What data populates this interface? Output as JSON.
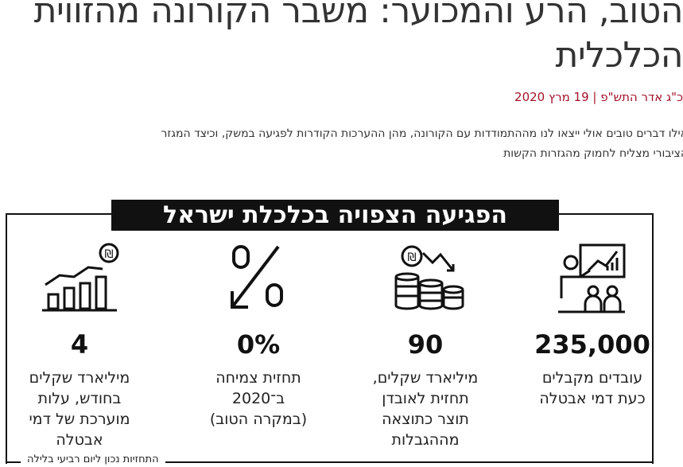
{
  "article": {
    "title_line1": "הטוב, הרע והמכוער: משבר הקורונה מהזווית",
    "title_line2": "הכלכלית",
    "dateline": "כ\"ג אדר התש\"פ | 19 מרץ 2020",
    "lead_line1": "אילו דברים טובים אולי ייצאו לנו מההתמודדות עם הקורונה, מהן ההערכות הקודרות לפגיעה במשק, וכיצד המגזר",
    "lead_line2": "הציבורי מצליח לחמוק מהגזרות הקשות"
  },
  "infographic": {
    "heading": "הפגיעה הצפויה בכלכלת ישראל",
    "footnote": "התחזיות נכון ליום רביעי בלילה",
    "stats": [
      {
        "value": "235,000",
        "desc_lines": [
          "עובדים מקבלים",
          "כעת דמי אבטלה"
        ],
        "icon": "presentation-icon"
      },
      {
        "value": "90",
        "desc_lines": [
          "מיליארד שקלים,",
          "תחזית לאובדן",
          "תוצר כתוצאה",
          "מההגבלות"
        ],
        "icon": "coins-down-icon"
      },
      {
        "value": "0%",
        "desc_lines": [
          "תחזית צמיחה",
          "ב־2020",
          "(במקרה הטוב)"
        ],
        "icon": "percent-down-icon"
      },
      {
        "value": "4",
        "desc_lines": [
          "מיליארד שקלים",
          "בחודש, עלות",
          "מוערכת של דמי",
          "אבטלה"
        ],
        "icon": "chart-up-icon"
      }
    ]
  }
}
